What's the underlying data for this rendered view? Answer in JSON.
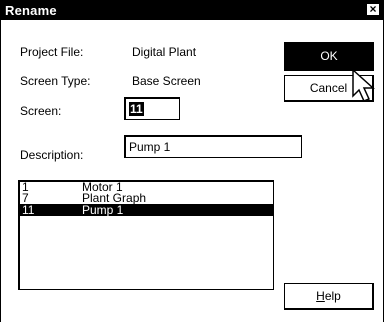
{
  "window": {
    "title": "Rename",
    "close_glyph": "×"
  },
  "project_file": {
    "label": "Project File:",
    "value": "Digital Plant"
  },
  "screen_type": {
    "label": "Screen Type:",
    "value": "Base Screen"
  },
  "screen": {
    "label": "Screen:",
    "value": "11"
  },
  "description": {
    "label": "Description:",
    "value": "Pump 1"
  },
  "buttons": {
    "ok": "OK",
    "cancel": "Cancel",
    "help_mnemonic": "H",
    "help_rest": "elp"
  },
  "screen_list": [
    {
      "number": "1",
      "name": "Motor 1",
      "selected": false
    },
    {
      "number": "7",
      "name": "Plant Graph",
      "selected": false
    },
    {
      "number": "11",
      "name": "Pump 1",
      "selected": true
    }
  ],
  "icons": {
    "cursor": "mouse-pointer-icon",
    "close": "close-icon"
  }
}
